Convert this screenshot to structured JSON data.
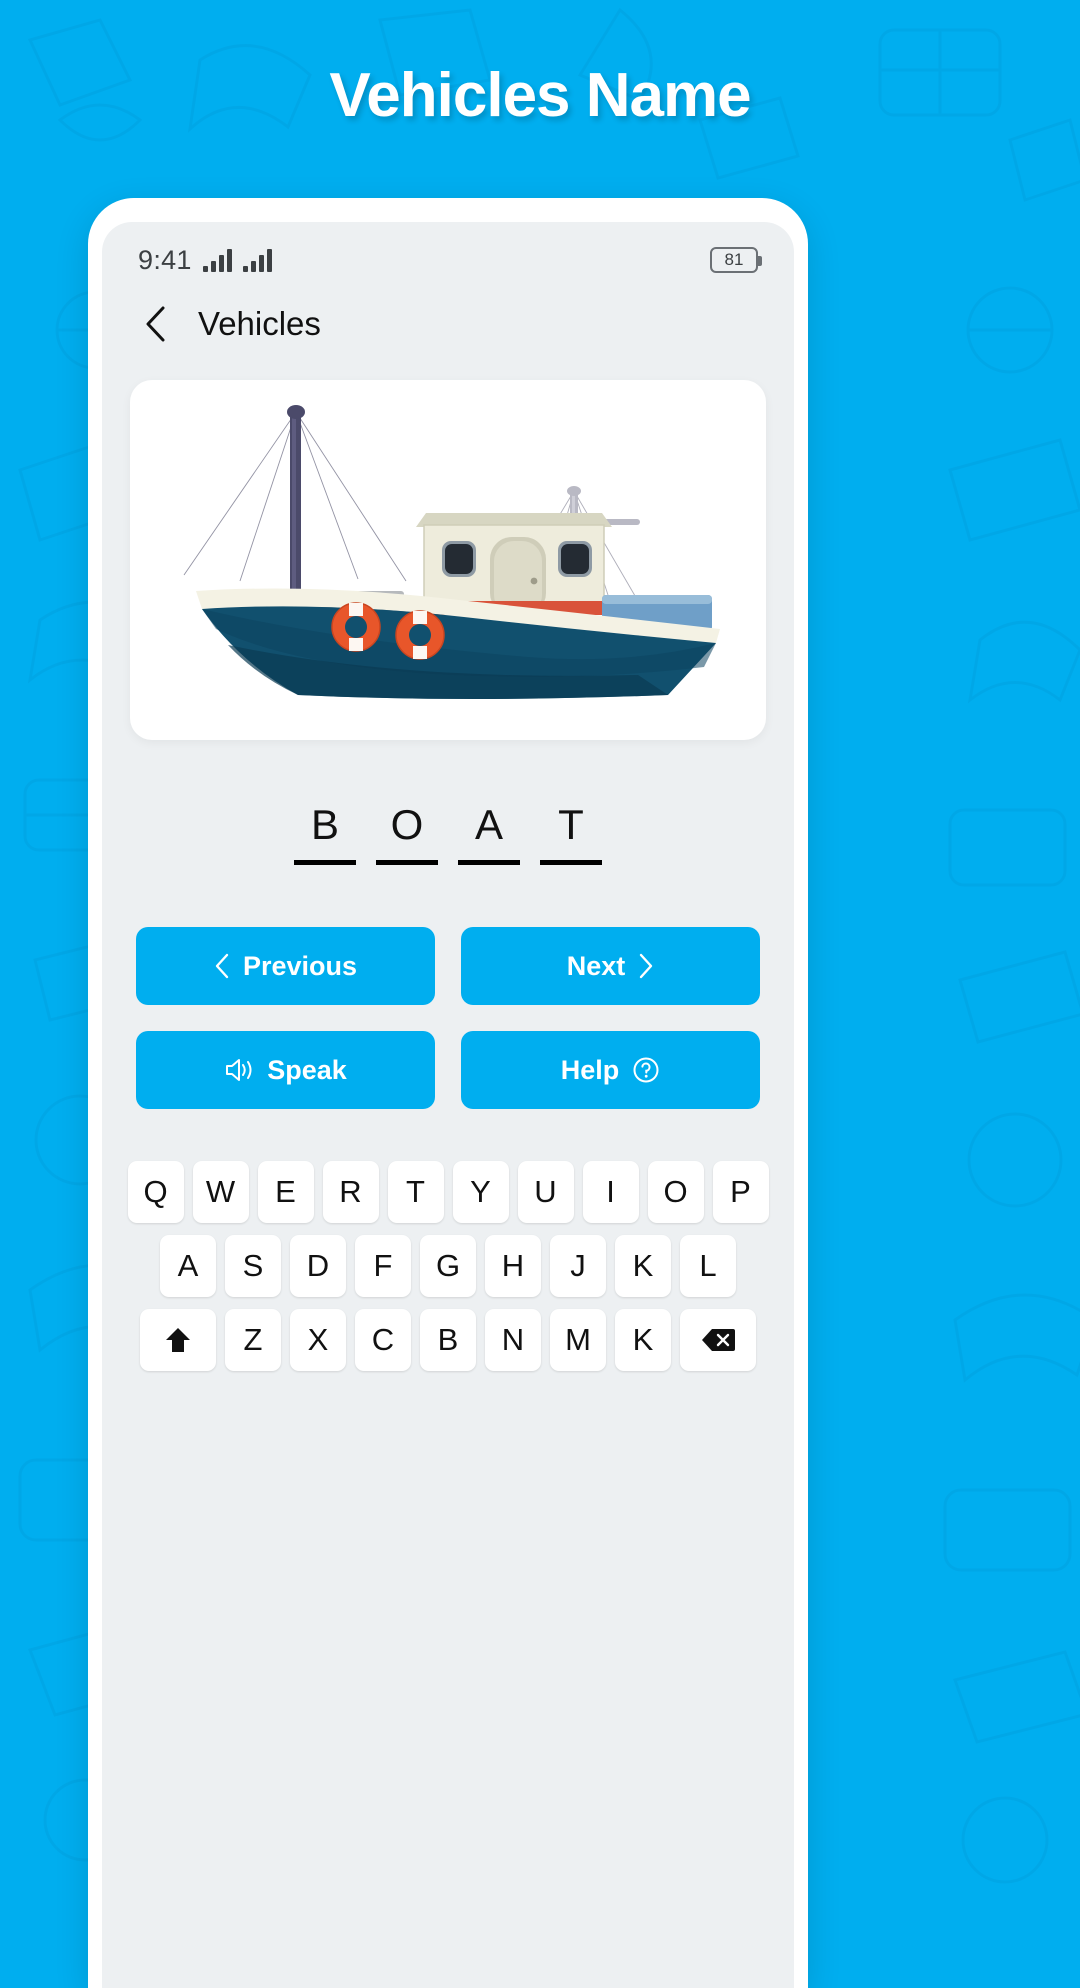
{
  "banner": {
    "title": "Vehicles Name",
    "background_color": "#00AEEF",
    "title_color": "#FFFFFF"
  },
  "status_bar": {
    "time": "9:41",
    "battery_level": "81",
    "signal_icon_1": "signal-bars-icon",
    "signal_icon_2": "signal-bars-icon"
  },
  "app_header": {
    "back_icon": "chevron-left-icon",
    "title": "Vehicles"
  },
  "image_card": {
    "illustration_name": "fishing-boat-illustration",
    "hull_color": "#11506E",
    "deck_color": "#F2EFE0",
    "cabin_color": "#E4E3D0",
    "mast_color": "#4B4A6A",
    "lifering_color": "#E8562A",
    "accent_color": "#D9533A"
  },
  "word_answer": {
    "letters": [
      "B",
      "O",
      "A",
      "T"
    ],
    "word": "BOAT"
  },
  "actions": [
    {
      "label": "Previous",
      "icon": "chevron-left-icon",
      "icon_position": "left",
      "name": "previous-button"
    },
    {
      "label": "Next",
      "icon": "chevron-right-icon",
      "icon_position": "right",
      "name": "next-button"
    },
    {
      "label": "Speak",
      "icon": "speaker-icon",
      "icon_position": "left",
      "name": "speak-button"
    },
    {
      "label": "Help",
      "icon": "question-circle-icon",
      "icon_position": "right",
      "name": "help-button"
    }
  ],
  "button_color": "#00AEEF",
  "keyboard": {
    "row1": [
      "Q",
      "W",
      "E",
      "R",
      "T",
      "Y",
      "U",
      "I",
      "O",
      "P"
    ],
    "row2": [
      "A",
      "S",
      "D",
      "F",
      "G",
      "H",
      "J",
      "K",
      "L"
    ],
    "row3_letters": [
      "Z",
      "X",
      "C",
      "B",
      "N",
      "M",
      "K"
    ],
    "shift_icon": "shift-up-arrow-icon",
    "backspace_icon": "backspace-icon"
  }
}
